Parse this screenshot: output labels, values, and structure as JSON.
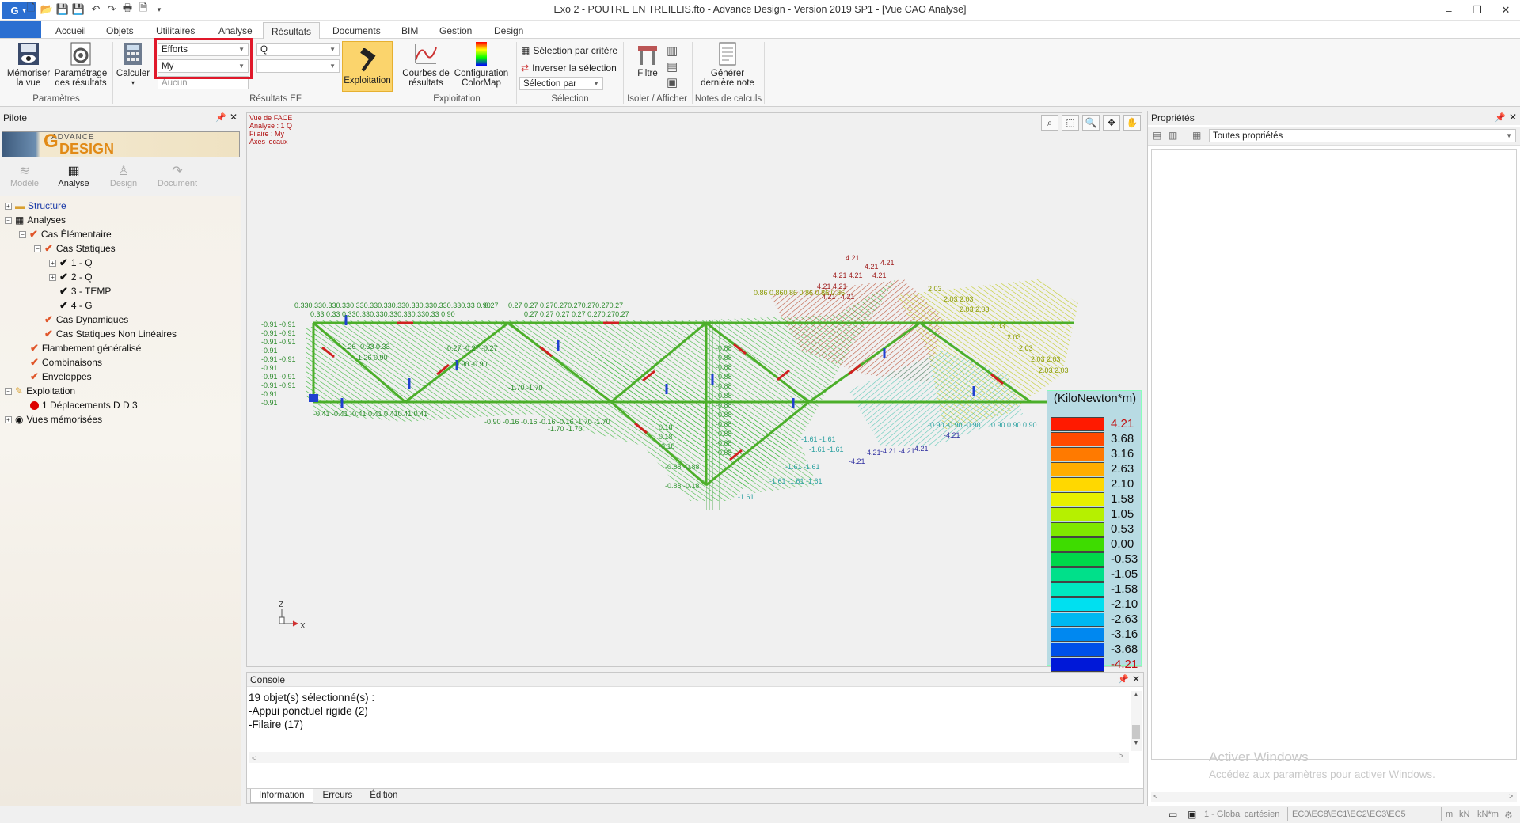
{
  "title_bar": {
    "title": "Exo 2 - POUTRE EN TREILLIS.fto - Advance Design - Version 2019 SP1 - [Vue CAO Analyse]"
  },
  "ribbon_tabs": [
    "Accueil",
    "Objets",
    "Utilitaires",
    "Analyse",
    "Résultats",
    "Documents",
    "BIM",
    "Gestion",
    "Design"
  ],
  "active_tab": "Résultats",
  "ribbon": {
    "memoriser": "Mémoriser\nla vue",
    "parametrage": "Paramétrage\ndes résultats",
    "group_parametres": "Paramètres",
    "calculer": "Calculer",
    "combo_type": "Efforts",
    "combo_component": "My",
    "combo_third": "Aucun",
    "combo_case": "Q",
    "group_resultats": "Résultats EF",
    "exploitation_btn": "Exploitation",
    "courbes": "Courbes de\nrésultats",
    "colormap": "Configuration\nColorMap",
    "group_exploitation": "Exploitation",
    "sel_critere": "Sélection par critère",
    "sel_inverser": "Inverser la sélection",
    "sel_par": "Sélection par",
    "group_selection": "Sélection",
    "filtre": "Filtre",
    "group_isoler": "Isoler / Afficher",
    "generer": "Générer\ndernière note",
    "group_notes": "Notes de calculs"
  },
  "pilot": {
    "title": "Pilote",
    "logo_small": "ADVANCE",
    "logo_big": "DESIGN",
    "modes": [
      "Modèle",
      "Analyse",
      "Design",
      "Document"
    ],
    "tree": [
      {
        "label": "Structure"
      },
      {
        "label": "Analyses"
      },
      {
        "label": "Cas Élémentaire"
      },
      {
        "label": "Cas Statiques"
      },
      {
        "label": "1 - Q"
      },
      {
        "label": "2 - Q"
      },
      {
        "label": "3 - TEMP"
      },
      {
        "label": "4 - G"
      },
      {
        "label": "Cas Dynamiques"
      },
      {
        "label": "Cas Statiques Non Linéaires"
      },
      {
        "label": "Flambement généralisé"
      },
      {
        "label": "Combinaisons"
      },
      {
        "label": "Enveloppes"
      },
      {
        "label": "Exploitation"
      },
      {
        "label": "1 Déplacements D  D  3"
      },
      {
        "label": "Vues mémorisées"
      }
    ]
  },
  "viewport": {
    "info": [
      "Vue de FACE",
      "Analyse : 1 Q",
      "Filaire : My",
      "Axes locaux"
    ],
    "axis_z": "Z",
    "axis_x": "X"
  },
  "legend": {
    "unit": "(KiloNewton*m)",
    "values": [
      "4.21",
      "3.68",
      "3.16",
      "2.63",
      "2.10",
      "1.58",
      "1.05",
      "0.53",
      "0.00",
      "-0.53",
      "-1.05",
      "-1.58",
      "-2.10",
      "-2.63",
      "-3.16",
      "-3.68",
      "-4.21"
    ],
    "colors": [
      "#ff1a00",
      "#ff4a00",
      "#ff7a00",
      "#ffad00",
      "#ffd800",
      "#e8f000",
      "#b6f000",
      "#7fe800",
      "#3edc00",
      "#00d84a",
      "#00e08a",
      "#00e8c0",
      "#00e0f0",
      "#00b8f0",
      "#0088f0",
      "#0050e8",
      "#0018d8"
    ]
  },
  "console": {
    "title": "Console",
    "lines": [
      "19 objet(s) sélectionné(s) :",
      "-Appui ponctuel rigide (2)",
      "-Filaire (17)"
    ],
    "tabs": [
      "Information",
      "Erreurs",
      "Édition"
    ]
  },
  "properties": {
    "title": "Propriétés",
    "filter": "Toutes propriétés",
    "watermark_1": "Activer Windows",
    "watermark_2": "Accédez aux paramètres pour activer Windows."
  },
  "status": {
    "coord": "1 - Global cartésien",
    "codes": "EC0\\EC8\\EC1\\EC2\\EC3\\EC5",
    "units": [
      "m",
      "kN",
      "kN*m"
    ]
  }
}
